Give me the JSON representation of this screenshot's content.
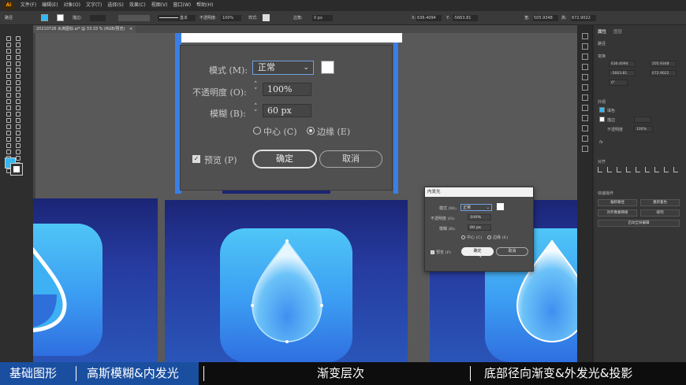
{
  "menubar": {
    "app_icon": "Ai",
    "items": [
      "文件(F)",
      "编辑(E)",
      "对象(O)",
      "文字(T)",
      "选择(S)",
      "效果(C)",
      "视图(V)",
      "窗口(W)",
      "帮助(H)"
    ]
  },
  "control_bar": {
    "left_label": "路径",
    "stroke_label": "描边:",
    "stroke_style": "基本",
    "opacity_label": "不透明度:",
    "opacity_value": "100%",
    "style_label": "样式:",
    "corner_label": "边角:",
    "corner_value": "0 px",
    "x_label": "X:",
    "x_value": "636.4094",
    "y_label": "Y:",
    "y_value": "-5663.81",
    "w_label": "宽:",
    "w_value": "505.9348",
    "h_label": "高:",
    "h_value": "672.9022"
  },
  "document_tab": {
    "title": "20210726 水滴图标.ai* @ 33.33 % (RGB/预览)",
    "close": "×"
  },
  "big_dialog": {
    "mode_label": "模式 (M):",
    "mode_value": "正常",
    "opacity_label": "不透明度 (O):",
    "opacity_value": "100%",
    "blur_label": "模糊 (B):",
    "blur_value": "60 px",
    "center_label": "中心 (C)",
    "edge_label": "边缘 (E)",
    "preview_label": "预览 (P)",
    "ok_label": "确定",
    "cancel_label": "取消"
  },
  "small_dialog": {
    "title": "内发光",
    "mode_label": "模式 (M):",
    "mode_value": "正常",
    "opacity_label": "不透明度 (O):",
    "opacity_value": "100%",
    "blur_label": "模糊 (B):",
    "blur_value": "60 px",
    "center_label": "中心 (C)",
    "edge_label": "边缘 (E)",
    "preview_label": "预览 (P)",
    "ok_label": "确定",
    "cancel_label": "取消"
  },
  "right_panel": {
    "tab_properties": "属性",
    "tab_layers": "图层",
    "section_path": "路径",
    "section_transform": "变换",
    "x_value": "636.4094",
    "y_value": "-5663.81",
    "w_value": "505.9348",
    "h_value": "672.9022",
    "angle_value": "0°",
    "section_appearance": "外观",
    "fill_label": "填色",
    "stroke_label": "描边",
    "opacity_label": "不透明度",
    "opacity_value": "100%",
    "fx_label": "fx",
    "section_align": "对齐",
    "section_quick": "快速操作",
    "quick_btn_1": "偏移路径",
    "quick_btn_2": "重新着色",
    "quick_btn_3": "对齐像素网格",
    "quick_btn_4": "排列",
    "quick_btn_5": "启动全局编辑"
  },
  "subtitle_bar": {
    "seg1": "基础图形",
    "seg2": "高斯模糊&内发光",
    "seg3": "渐变层次",
    "seg4": "底部径向渐变&外发光&投影"
  },
  "colors": {
    "fill_swatch": "#35b7f1",
    "accent_blue": "#2f6fe0",
    "icon_light": "#4fc6f7",
    "subtitle_highlight": "#1a4fa0"
  }
}
